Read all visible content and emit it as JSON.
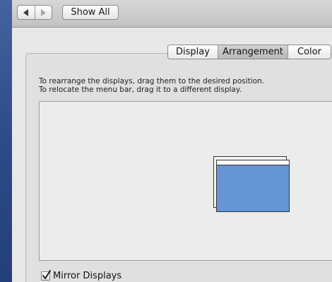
{
  "toolbar": {
    "back_icon": "back-arrow-icon",
    "forward_icon": "forward-arrow-icon",
    "show_all_label": "Show All"
  },
  "tabs": [
    {
      "label": "Display",
      "selected": false
    },
    {
      "label": "Arrangement",
      "selected": true
    },
    {
      "label": "Color",
      "selected": false
    }
  ],
  "arrangement": {
    "instruction_line1": "To rearrange the displays, drag them to the desired position.",
    "instruction_line2": "To relocate the menu bar, drag it to a different display.",
    "display_color": "#6595d4"
  },
  "mirror": {
    "label": "Mirror Displays",
    "checked": true
  }
}
